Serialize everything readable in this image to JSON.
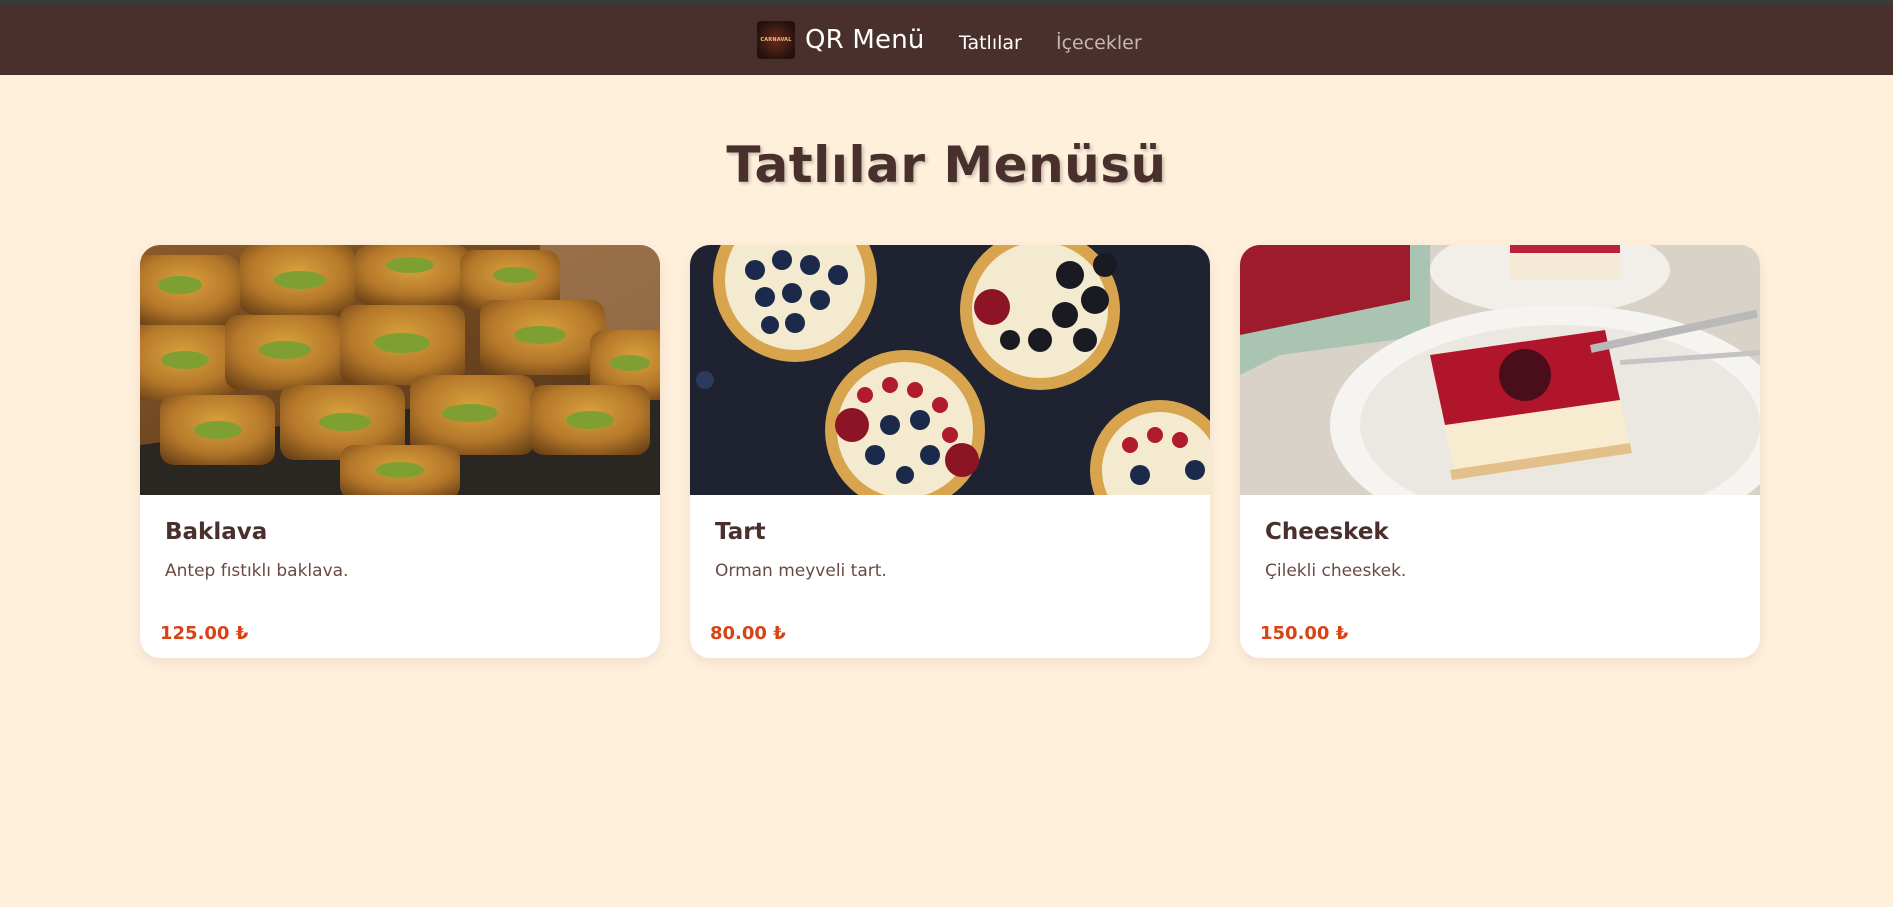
{
  "header": {
    "logo_text": "CARNAVAL",
    "brand": "QR Menü",
    "nav": [
      {
        "label": "Tatlılar",
        "active": true
      },
      {
        "label": "İçecekler",
        "active": false
      }
    ]
  },
  "page": {
    "title": "Tatlılar Menüsü"
  },
  "products": [
    {
      "name": "Baklava",
      "description": "Antep fıstıklı baklava.",
      "price": "125.00 ₺",
      "image": "baklava-photo"
    },
    {
      "name": "Tart",
      "description": "Orman meyveli tart.",
      "price": "80.00 ₺",
      "image": "berry-tart-photo"
    },
    {
      "name": "Cheeskek",
      "description": "Çilekli cheeskek.",
      "price": "150.00 ₺",
      "image": "cheesecake-photo"
    }
  ],
  "colors": {
    "header_bg": "#4a302c",
    "page_bg": "#fff0dc",
    "title": "#4a302c",
    "price": "#d84315"
  }
}
